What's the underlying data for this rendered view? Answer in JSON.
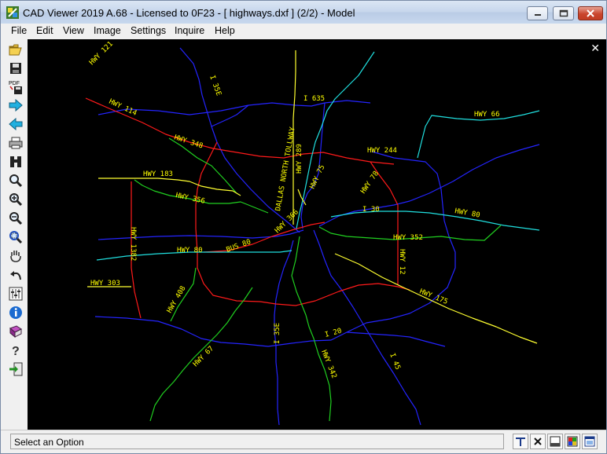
{
  "window": {
    "title": "CAD Viewer 2019 A.68 - Licensed to 0F23  -  [ highways.dxf ] (2/2)  -  Model"
  },
  "menu": [
    "File",
    "Edit",
    "View",
    "Image",
    "Settings",
    "Inquire",
    "Help"
  ],
  "toolbar": {
    "icons": [
      "open-folder-icon",
      "save-icon",
      "pdf-save-icon",
      "next-arrow-icon",
      "previous-arrow-icon",
      "print-icon",
      "binoculars-icon",
      "magnify-icon",
      "zoom-in-icon",
      "zoom-out-icon",
      "zoom-window-icon",
      "pan-hand-icon",
      "undo-icon",
      "layers-icon",
      "info-icon",
      "book-icon",
      "help-icon",
      "exit-icon"
    ]
  },
  "drawing": {
    "labels": {
      "hwy121": "HWY 121",
      "i35e_top": "I 35E",
      "i635": "I 635",
      "hwy66": "HWY 66",
      "hwy114": "HWY 114",
      "dnt": "DALLAS NORTH TOLLWAY",
      "hwy289": "HWY 289",
      "hwy348": "HWY 348",
      "hwy244": "HWY 244",
      "hwy183": "HWY 183",
      "hwy75": "HWY 75",
      "hwy78": "HWY 78",
      "hwy356": "HWY 356",
      "hwy366": "HWY 366",
      "i30": "I 30",
      "hwy80r": "HWY 80",
      "hwy1382": "HWY 1382",
      "bus80": "BUS 80",
      "hwy352": "HWY 352",
      "hwy80l": "HWY 80",
      "hwy12": "HWY 12",
      "hwy303": "HWY 303",
      "hwy408": "HWY 408",
      "hwy175": "HWY 175",
      "i20": "I 20",
      "i35e_bottom": "I 35E",
      "hwy67": "HWY 67",
      "hwy342": "HWY 342",
      "i45": "I 45"
    },
    "colors": {
      "background": "#000000",
      "blue": "#2020ff",
      "red": "#e01010",
      "cyan": "#20e0e0",
      "green": "#20d020",
      "yellow": "#ffff20",
      "lightblue": "#30a0ff"
    }
  },
  "status": {
    "text": "Select an Option",
    "buttons": [
      "text-toggle-icon",
      "close-x-icon",
      "window-icon",
      "color-palette-icon",
      "screen-icon"
    ]
  }
}
